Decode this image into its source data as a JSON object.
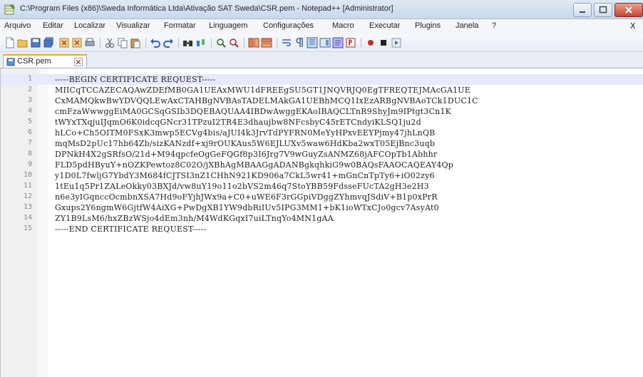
{
  "window": {
    "title": "C:\\Program Files (x86)\\Sweda Informática Ltda\\Ativação SAT Sweda\\CSR.pem - Notepad++ [Administrator]"
  },
  "menu": {
    "items": [
      "Arquivo",
      "Editar",
      "Localizar",
      "Visualizar",
      "Formatar",
      "Linguagem",
      "Configurações",
      "Macro",
      "Executar",
      "Plugins",
      "Janela",
      "?"
    ],
    "close_glyph": "X"
  },
  "toolbar": {
    "icons": [
      "new-file-icon",
      "open-file-icon",
      "save-icon",
      "save-all-icon",
      "close-icon",
      "close-all-icon",
      "print-icon",
      "cut-icon",
      "copy-icon",
      "paste-icon",
      "undo-icon",
      "redo-icon",
      "find-icon",
      "replace-icon",
      "zoom-in-icon",
      "zoom-out-icon",
      "sync-vertical-icon",
      "sync-horizontal-icon",
      "word-wrap-icon",
      "show-all-chars-icon",
      "indent-guide-icon",
      "document-map-icon",
      "function-list-icon",
      "folder-workspace-icon",
      "record-macro-icon",
      "stop-macro-icon",
      "play-macro-icon"
    ]
  },
  "tab": {
    "label": "CSR.pem"
  },
  "editor": {
    "current_line": 1,
    "lines": [
      "-----BEGIN CERTIFICATE REQUEST-----",
      "MIICqTCCAZECAQAwZDEfMB0GA1UEAxMWU1dFREEgSU5GT1JNQVRJQ0EgTFREQTEJMAcGA1UE",
      "CxMAMQkwBwYDVQQLEwAxCTAHBgNVBAsTADELMAkGA1UEBhMCQ1IxEzARBgNVBAoTCk1DUC1C",
      "cmFzaWwwggEiMA0GCSqGSIb3DQEBAQUAA4IBDwAwggEKAoIBAQCLTnR9ShyJm9IPtgt3Cn1K",
      "tWYxTXqjuIJqmO6K0idcqGNcr31TPzuI2TR4E3dhaujbw8NFcsbyC45rETCndyiKLSQ1ju2d",
      "hLCo+Ch5OITM0FSxK3mwp5ECVg4bis/aJUI4k3JrvTdPYFRN0MeYyHPxvEEYPjmy47jhLnQB",
      "mqMsD2pUc17hb64Zb/sizKANzdf+xj9rOUKAus5W6EJLUXv5waw6HdKba2wxT05EjBnc3uqb",
      "DPNkH4X2gSRfsO/21d+M94qpcfeOgGeFQGf8p3I6Jrg7V9wGuyZsANMZ68jAFCOpTb1Abhhr",
      "FLD5pdHByuY+nOZKPewtoz8C02O/jXBhAgMBAAGgADANBgkqhkiG9w0BAQsFAAOCAQEAY4Qp",
      "y1D0L7fwljG7YbdY3M684fCJTSI3nZ1CHhN921KD906a7CkL5wr41+mGnCnTpTy6+iO02zy6",
      "1tEu1q5Pr1ZALeOkky03BXJd/vw8uY19o11o2bVS2m46q7StoYBB59FdsseFUcTA2gH3e2H3",
      "n6e3yIGqnccOcmbnXSA7Hd9oFYjhJWx9a+C0+uWE6F3rGGpiVDggZYhmvqJSdiV+B1p0xPrR",
      "Gxups2Y6ngmW6GjtfW4AiXG+PwDgXB1YW9dbRiIUv5IPG3MM1+bK1ioWTxCJo0gcv7AsyAt0",
      "ZY1B9LsM6/hxZBzWSjo4dEm3nh/M4WdKGqxI7uiLTnqYo4MN1gAA",
      "-----END CERTIFICATE REQUEST-----"
    ]
  },
  "colors": {
    "current_line_bg": "#e8e8ff",
    "tab_accent": "#f2a23a",
    "gutter_bg": "#f0f0f0"
  }
}
